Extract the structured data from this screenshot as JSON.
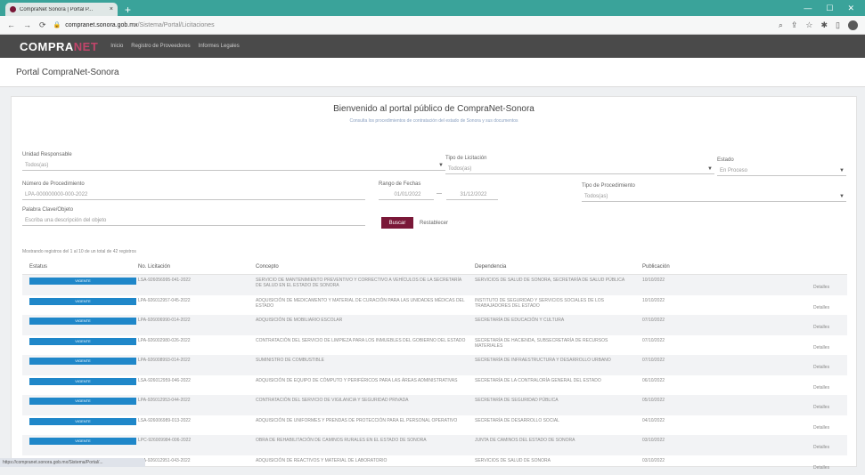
{
  "browser": {
    "tab_title": "CompraNet Sonora | Portal P...",
    "tab_close": "×",
    "new_tab": "+",
    "url_host": "compranet.sonora.gob.mx",
    "url_path": "/Sistema/Portal/Licitaciones",
    "status_url": "https://compranet.sonora.gob.mx/Sistema/Portal/..."
  },
  "app": {
    "logo_main": "COMPRA",
    "logo_accent": "NET",
    "menu": [
      "Inicio",
      "Registro de Proveedores",
      "Informes Legales"
    ]
  },
  "page": {
    "title": "Portal CompraNet-Sonora",
    "welcome_title": "Bienvenido al portal público de CompraNet-Sonora",
    "welcome_subtitle": "Consulta los procedimientos de contratación del estado de Sonora y sus documentos"
  },
  "filters": {
    "unidad_label": "Unidad Responsable",
    "unidad_value": "Todos(as)",
    "tipo_label": "Tipo de Licitación",
    "tipo_value": "Todos(as)",
    "estado_label": "Estado",
    "estado_value": "En Proceso",
    "numero_label": "Número de Procedimiento",
    "numero_value": "LPA-000000000-000-2022",
    "rango_label": "Rango de Fechas",
    "fecha_inicio": "01/01/2022",
    "fecha_sep": "—",
    "fecha_fin": "31/12/2022",
    "tipo_proc_label": "Tipo de Procedimiento",
    "tipo_proc_value": "Todos(as)",
    "palabra_label": "Palabra Clave/Objeto",
    "palabra_value": "Escriba una descripción del objeto",
    "search_btn": "Buscar",
    "reset_btn": "Restablecer"
  },
  "results_info": "Mostrando registros del 1 al 10 de un total de 42 registros",
  "table": {
    "headers": [
      "Estatus",
      "No. Licitación",
      "Concepto",
      "Dependencia",
      "Publicación",
      ""
    ],
    "rows": [
      {
        "status": "VIGENTE",
        "num": "LSA-926056995-041-2022",
        "concepto": "SERVICIO DE MANTENIMIENTO PREVENTIVO Y CORRECTIVO A VEHÍCULOS DE LA SECRETARÍA DE SALUD EN EL ESTADO DE SONORA",
        "dependencia": "SERVICIOS DE SALUD DE SONORA, SECRETARÍA DE SALUD PÚBLICA",
        "fecha": "10/10/2022",
        "accion": "Detalles"
      },
      {
        "status": "VIGENTE",
        "num": "LPA-926012957-045-2022",
        "concepto": "ADQUISICIÓN DE MEDICAMENTO Y MATERIAL DE CURACIÓN PARA LAS UNIDADES MÉDICAS DEL ESTADO",
        "dependencia": "INSTITUTO DE SEGURIDAD Y SERVICIOS SOCIALES DE LOS TRABAJADORES DEL ESTADO",
        "fecha": "10/10/2022",
        "accion": "Detalles"
      },
      {
        "status": "VIGENTE",
        "num": "LPA-926006990-014-2022",
        "concepto": "ADQUISICIÓN DE MOBILIARIO ESCOLAR",
        "dependencia": "SECRETARÍA DE EDUCACIÓN Y CULTURA",
        "fecha": "07/10/2022",
        "accion": "Detalles"
      },
      {
        "status": "VIGENTE",
        "num": "LPA-926002980-026-2022",
        "concepto": "CONTRATACIÓN DEL SERVICIO DE LIMPIEZA PARA LOS INMUEBLES DEL GOBIERNO DEL ESTADO",
        "dependencia": "SECRETARÍA DE HACIENDA, SUBSECRETARÍA DE RECURSOS MATERIALES",
        "fecha": "07/10/2022",
        "accion": "Detalles"
      },
      {
        "status": "VIGENTE",
        "num": "LPA-926008993-014-2022",
        "concepto": "SUMINISTRO DE COMBUSTIBLE",
        "dependencia": "SECRETARÍA DE INFRAESTRUCTURA Y DESARROLLO URBANO",
        "fecha": "07/10/2022",
        "accion": "Detalles"
      },
      {
        "status": "VIGENTE",
        "num": "LSA-926012959-046-2022",
        "concepto": "ADQUISICIÓN DE EQUIPO DE CÓMPUTO Y PERIFÉRICOS PARA LAS ÁREAS ADMINISTRATIVAS",
        "dependencia": "SECRETARÍA DE LA CONTRALORÍA GENERAL DEL ESTADO",
        "fecha": "06/10/2022",
        "accion": "Detalles"
      },
      {
        "status": "VIGENTE",
        "num": "LPA-926012953-044-2022",
        "concepto": "CONTRATACIÓN DEL SERVICIO DE VIGILANCIA Y SEGURIDAD PRIVADA",
        "dependencia": "SECRETARÍA DE SEGURIDAD PÚBLICA",
        "fecha": "05/10/2022",
        "accion": "Detalles"
      },
      {
        "status": "VIGENTE",
        "num": "LSA-926006989-013-2022",
        "concepto": "ADQUISICIÓN DE UNIFORMES Y PRENDAS DE PROTECCIÓN PARA EL PERSONAL OPERATIVO",
        "dependencia": "SECRETARÍA DE DESARROLLO SOCIAL",
        "fecha": "04/10/2022",
        "accion": "Detalles"
      },
      {
        "status": "VIGENTE",
        "num": "LPC-926009984-006-2022",
        "concepto": "OBRA DE REHABILITACIÓN DE CAMINOS RURALES EN EL ESTADO DE SONORA",
        "dependencia": "JUNTA DE CAMINOS DEL ESTADO DE SONORA",
        "fecha": "03/10/2022",
        "accion": "Detalles"
      },
      {
        "status": "VIGENTE",
        "num": "LPA-926012951-043-2022",
        "concepto": "ADQUISICIÓN DE REACTIVOS Y MATERIAL DE LABORATORIO",
        "dependencia": "SERVICIOS DE SALUD DE SONORA",
        "fecha": "03/10/2022",
        "accion": "Detalles"
      }
    ]
  }
}
